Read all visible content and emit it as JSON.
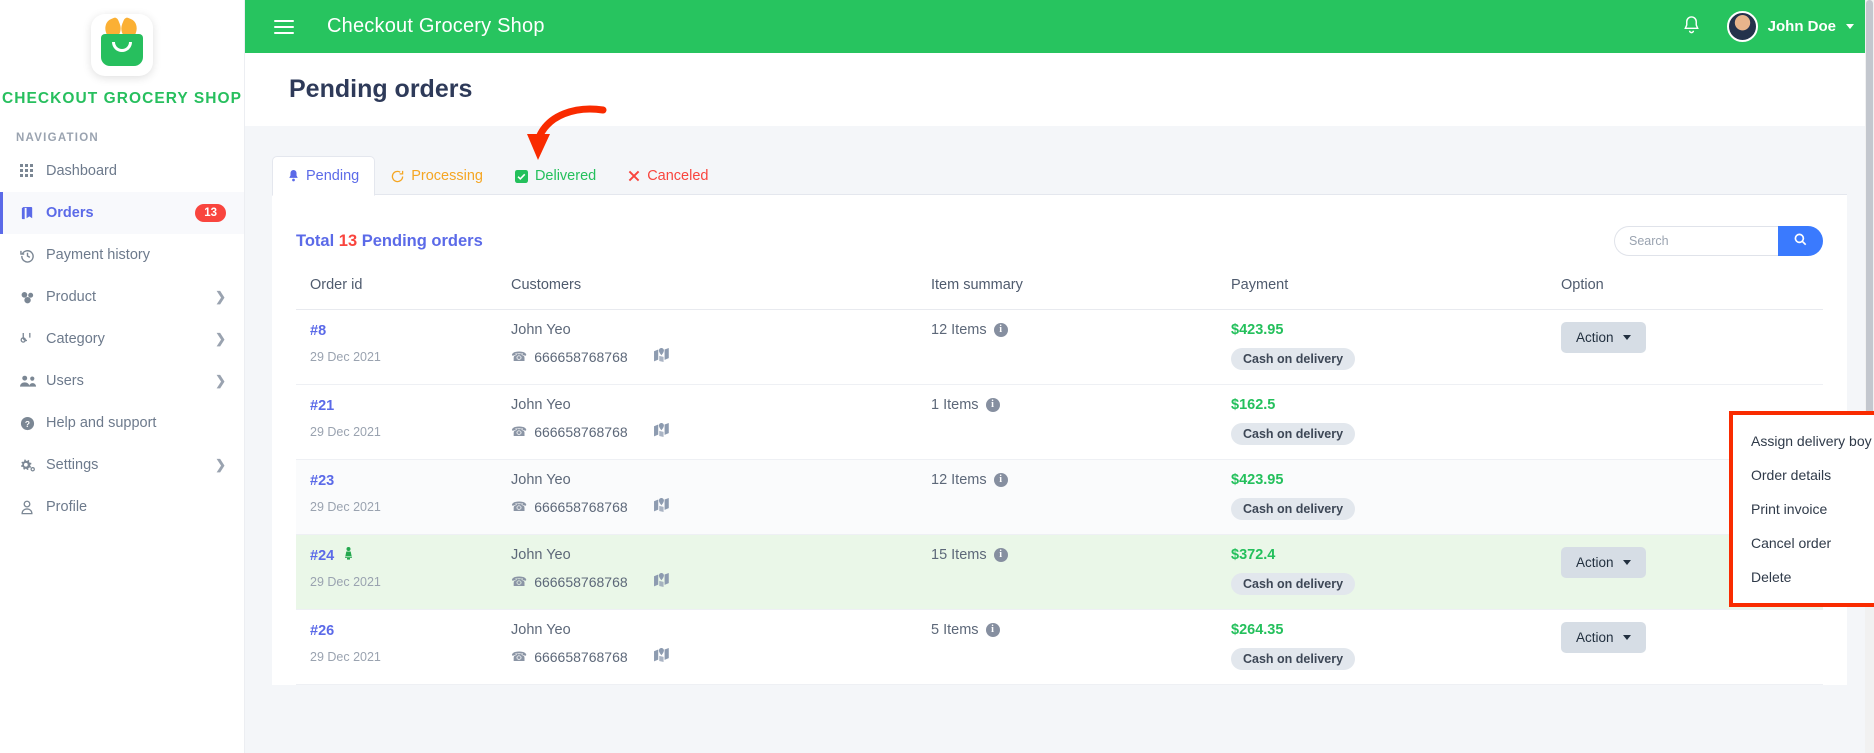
{
  "sidebar": {
    "brand_name": "CHECKOUT GROCERY SHOP",
    "nav_label": "NAVIGATION",
    "items": [
      {
        "label": "Dashboard",
        "icon": "grid-icon",
        "glyph": "▒",
        "badge": null,
        "chevron": false,
        "active": false
      },
      {
        "label": "Orders",
        "icon": "orders-book-icon",
        "glyph": "◧",
        "badge": "13",
        "chevron": false,
        "active": true
      },
      {
        "label": "Payment history",
        "icon": "history-icon",
        "glyph": "↺",
        "badge": null,
        "chevron": false,
        "active": false
      },
      {
        "label": "Product",
        "icon": "product-cubes-icon",
        "glyph": "❖",
        "badge": null,
        "chevron": true,
        "active": false
      },
      {
        "label": "Category",
        "icon": "category-icon",
        "glyph": "⑂",
        "badge": null,
        "chevron": true,
        "active": false
      },
      {
        "label": "Users",
        "icon": "users-icon",
        "glyph": "♟",
        "badge": null,
        "chevron": true,
        "active": false
      },
      {
        "label": "Help and support",
        "icon": "help-circle-icon",
        "glyph": "❓",
        "badge": null,
        "chevron": false,
        "active": false
      },
      {
        "label": "Settings",
        "icon": "gear-icon",
        "glyph": "⚙",
        "badge": null,
        "chevron": true,
        "active": false
      },
      {
        "label": "Profile",
        "icon": "user-icon",
        "glyph": "☺",
        "badge": null,
        "chevron": false,
        "active": false
      }
    ]
  },
  "topbar": {
    "title": "Checkout Grocery Shop",
    "menu_icon": "hamburger-icon",
    "bell_icon": "notification-bell-icon",
    "user_name": "John Doe",
    "avatar_icon": "user-avatar"
  },
  "page": {
    "title": "Pending orders"
  },
  "tabs": [
    {
      "label": "Pending",
      "icon": "bell-icon",
      "glyph": "🔔",
      "active": true
    },
    {
      "label": "Processing",
      "icon": "spinner-icon",
      "glyph": "↻",
      "active": false
    },
    {
      "label": "Delivered",
      "icon": "check-box-icon",
      "glyph": "☑",
      "active": false
    },
    {
      "label": "Canceled",
      "icon": "x-mark-icon",
      "glyph": "✕",
      "active": false
    }
  ],
  "card": {
    "total_prefix": "Total",
    "total_count": "13",
    "total_suffix": "Pending orders",
    "search_placeholder": "Search",
    "search_value": "",
    "search_icon": "search-icon",
    "search_button_label": ""
  },
  "table": {
    "columns": [
      "Order id",
      "Customers",
      "Item summary",
      "Payment",
      "Option"
    ],
    "action_label": "Action",
    "rows": [
      {
        "order_id": "#8",
        "date": "29 Dec 2021",
        "customer": "John Yeo",
        "phone": "666658768768",
        "items": "12 Items",
        "price": "$423.95",
        "payment_method": "Cash on delivery",
        "highlight": false,
        "leaf": false
      },
      {
        "order_id": "#21",
        "date": "29 Dec 2021",
        "customer": "John Yeo",
        "phone": "666658768768",
        "items": "1 Items",
        "price": "$162.5",
        "payment_method": "Cash on delivery",
        "highlight": false,
        "leaf": false
      },
      {
        "order_id": "#23",
        "date": "29 Dec 2021",
        "customer": "John Yeo",
        "phone": "666658768768",
        "items": "12 Items",
        "price": "$423.95",
        "payment_method": "Cash on delivery",
        "highlight": false,
        "leaf": false
      },
      {
        "order_id": "#24",
        "date": "29 Dec 2021",
        "customer": "John Yeo",
        "phone": "666658768768",
        "items": "15 Items",
        "price": "$372.4",
        "payment_method": "Cash on delivery",
        "highlight": true,
        "leaf": true
      },
      {
        "order_id": "#26",
        "date": "29 Dec 2021",
        "customer": "John Yeo",
        "phone": "666658768768",
        "items": "5 Items",
        "price": "$264.35",
        "payment_method": "Cash on delivery",
        "highlight": false,
        "leaf": false
      }
    ]
  },
  "dropdown": {
    "items": [
      "Assign delivery boy",
      "Order details",
      "Print invoice",
      "Cancel order",
      "Delete"
    ]
  },
  "annotation": {
    "arrow_icon": "red-curved-arrow",
    "color": "#f92b00"
  },
  "colors": {
    "brand_green": "#27bf5e",
    "topbar_green": "#27c45f",
    "accent_blue": "#5b6ae8",
    "search_blue": "#3a7afe",
    "danger_red": "#f9453e",
    "warning_orange": "#f5a623",
    "price_green": "#24c05c",
    "highlight_row": "#eaf7e8",
    "annotation_red": "#f92b00"
  }
}
